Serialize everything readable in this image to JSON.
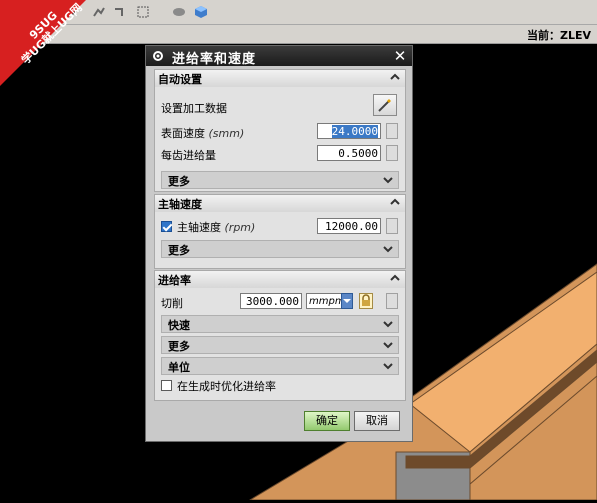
{
  "badge": {
    "line1": "9SUG",
    "line2": "学UG就上UG网"
  },
  "status": {
    "text": "当前：ZLEV"
  },
  "dialog": {
    "title": "进给率和速度",
    "sections": {
      "auto": {
        "header": "自动设置",
        "set_machining_data": "设置加工数据",
        "surface_speed_label": "表面速度",
        "surface_speed_unit": "(smm)",
        "surface_speed_value": "24.0000",
        "feed_per_tooth_label": "每齿进给量",
        "feed_per_tooth_value": "0.5000",
        "more": "更多"
      },
      "spindle": {
        "header": "主轴速度",
        "spindle_label": "主轴速度",
        "spindle_unit": "(rpm)",
        "spindle_value": "12000.00",
        "checked": true,
        "more": "更多"
      },
      "feed": {
        "header": "进给率",
        "cut_label": "切削",
        "cut_value": "3000.000",
        "cut_unit": "mmpm",
        "rapid": "快速",
        "more": "更多",
        "units": "单位",
        "optimize_label": "在生成时优化进给率",
        "optimize_checked": false
      }
    },
    "buttons": {
      "ok": "确定",
      "cancel": "取消"
    }
  },
  "colors": {
    "model": "#f2b06f",
    "model_shade": "#d3955a",
    "model_edge": "#6b4a2c"
  }
}
